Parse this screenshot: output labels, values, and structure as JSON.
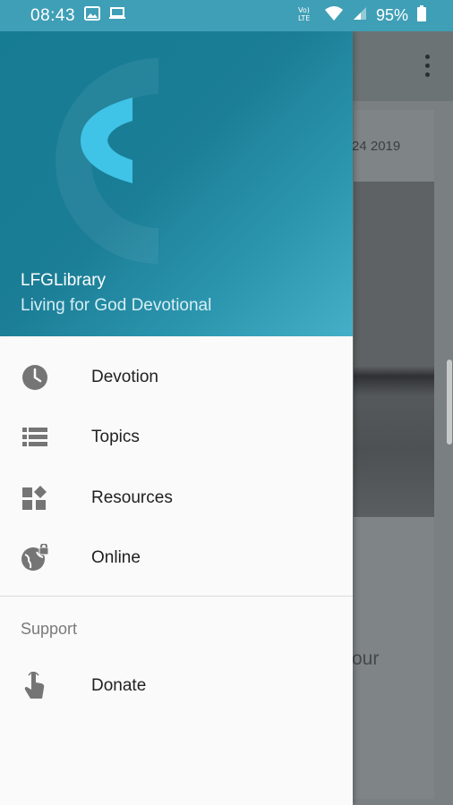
{
  "status_bar": {
    "time": "08:43",
    "battery": "95%",
    "icons": [
      "image-icon",
      "monitor-icon",
      "volte-icon",
      "wifi-icon",
      "signal-icon",
      "battery-icon"
    ]
  },
  "background_app": {
    "date": "24 2019",
    "partial_text": "our"
  },
  "drawer": {
    "header": {
      "title": "LFGLibrary",
      "subtitle": "Living for God Devotional"
    },
    "items": [
      {
        "label": "Devotion",
        "icon": "clock-icon"
      },
      {
        "label": "Topics",
        "icon": "list-icon"
      },
      {
        "label": "Resources",
        "icon": "widgets-icon"
      },
      {
        "label": "Online",
        "icon": "globe-lock-icon"
      }
    ],
    "support_section": {
      "label": "Support",
      "items": [
        {
          "label": "Donate",
          "icon": "touch-icon"
        }
      ]
    }
  },
  "colors": {
    "status_bar": "#3f9fb6",
    "header_start": "#167c94",
    "header_end": "#46afc8",
    "logo_accent": "#3fc3e6",
    "icon_gray": "#757575"
  }
}
